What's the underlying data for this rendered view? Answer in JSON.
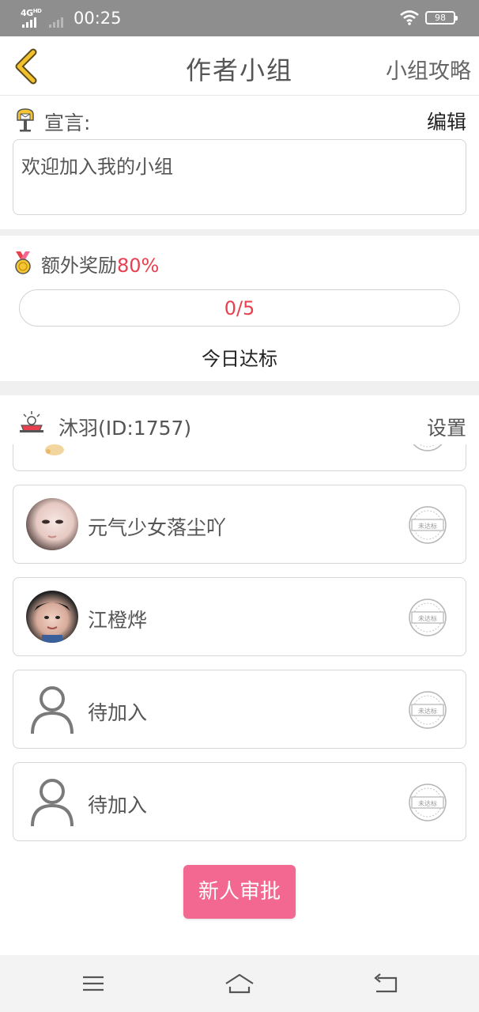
{
  "status_bar": {
    "network": "4G",
    "network_sup": "HD",
    "time": "00:25",
    "battery": "98"
  },
  "header": {
    "title": "作者小组",
    "right_link": "小组攻略"
  },
  "declaration": {
    "label": "宣言:",
    "edit_label": "编辑",
    "text": "欢迎加入我的小组"
  },
  "reward": {
    "label": "额外奖励",
    "percent": "80%",
    "progress_text": "0/5",
    "progress_fraction": 0,
    "today_label": "今日达标"
  },
  "group": {
    "owner": "沐羽(ID:1757)",
    "settings_label": "设置",
    "stamp_text": "未达标",
    "members": [
      {
        "name": "",
        "avatar": "cat-emoji-avatar"
      },
      {
        "name": "元气少女落尘吖",
        "avatar": "photo-avatar"
      },
      {
        "name": "江橙烨",
        "avatar": "photo-avatar"
      },
      {
        "name": "待加入",
        "avatar": "person-placeholder-icon"
      },
      {
        "name": "待加入",
        "avatar": "person-placeholder-icon"
      }
    ],
    "approve_button": "新人审批"
  },
  "colors": {
    "accent_pink": "#f26890",
    "alert_red": "#e8404f",
    "back_arrow": "#d9a300"
  }
}
